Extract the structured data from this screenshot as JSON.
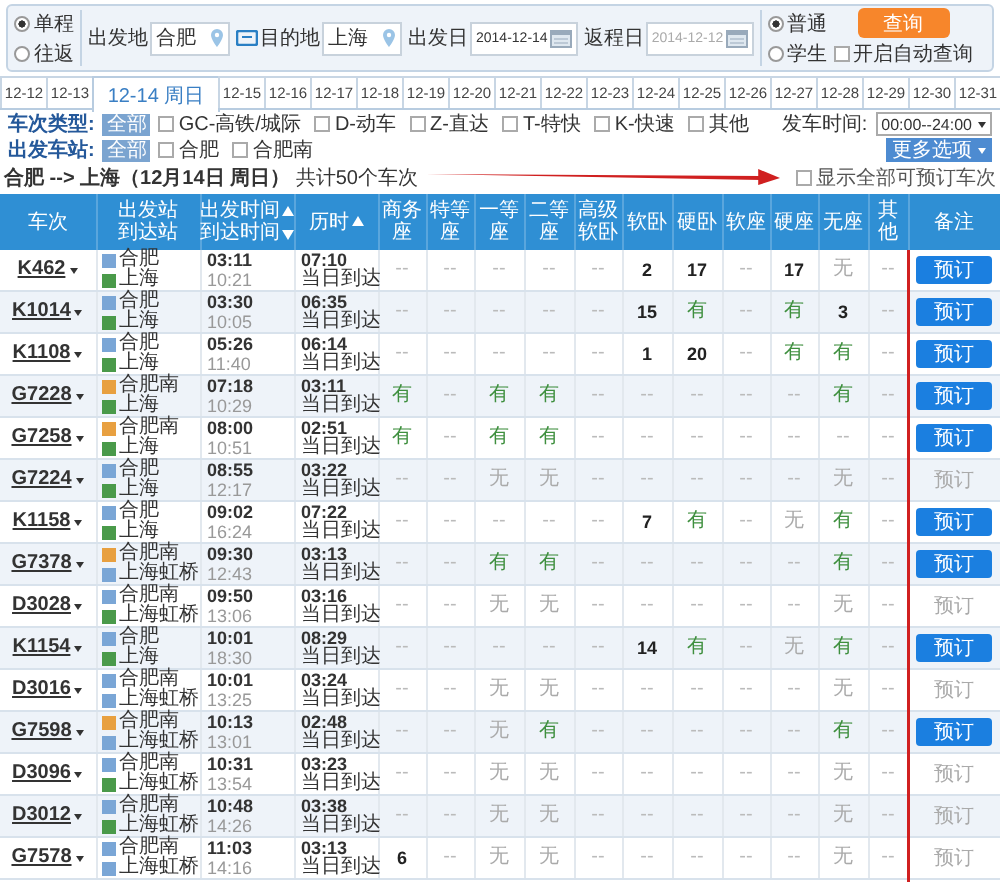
{
  "trip_type": [
    {
      "label": "单程",
      "selected": true
    },
    {
      "label": "往返",
      "selected": false
    }
  ],
  "from": {
    "label": "出发地",
    "value": "合肥"
  },
  "to": {
    "label": "目的地",
    "value": "上海"
  },
  "depart_date": {
    "label": "出发日",
    "value": "2014-12-14"
  },
  "return_date": {
    "label": "返程日",
    "value": "2014-12-12",
    "disabled": true
  },
  "passenger_type": [
    {
      "label": "普通",
      "selected": true
    },
    {
      "label": "学生",
      "selected": false
    }
  ],
  "search_button": "查询",
  "auto_query": {
    "label": "开启自动查询",
    "checked": false
  },
  "date_tabs": [
    {
      "label": "12-12",
      "selected": false
    },
    {
      "label": "12-13",
      "selected": false
    },
    {
      "label": "12-14 周日",
      "selected": true
    },
    {
      "label": "12-15",
      "selected": false
    },
    {
      "label": "12-16",
      "selected": false
    },
    {
      "label": "12-17",
      "selected": false
    },
    {
      "label": "12-18",
      "selected": false
    },
    {
      "label": "12-19",
      "selected": false
    },
    {
      "label": "12-20",
      "selected": false
    },
    {
      "label": "12-21",
      "selected": false
    },
    {
      "label": "12-22",
      "selected": false
    },
    {
      "label": "12-23",
      "selected": false
    },
    {
      "label": "12-24",
      "selected": false
    },
    {
      "label": "12-25",
      "selected": false
    },
    {
      "label": "12-26",
      "selected": false
    },
    {
      "label": "12-27",
      "selected": false
    },
    {
      "label": "12-28",
      "selected": false
    },
    {
      "label": "12-29",
      "selected": false
    },
    {
      "label": "12-30",
      "selected": false
    },
    {
      "label": "12-31",
      "selected": false
    }
  ],
  "train_type_filter": {
    "label": "车次类型:",
    "options": [
      {
        "label": "全部",
        "selected": true
      },
      {
        "label": "GC-高铁/城际",
        "selected": false
      },
      {
        "label": "D-动车",
        "selected": false
      },
      {
        "label": "Z-直达",
        "selected": false
      },
      {
        "label": "T-特快",
        "selected": false
      },
      {
        "label": "K-快速",
        "selected": false
      },
      {
        "label": "其他",
        "selected": false
      }
    ]
  },
  "departure_time": {
    "label": "发车时间:",
    "value": "00:00--24:00"
  },
  "station_filter": {
    "label": "出发车站:",
    "options": [
      {
        "label": "全部",
        "selected": true
      },
      {
        "label": "合肥",
        "selected": false
      },
      {
        "label": "合肥南",
        "selected": false
      }
    ]
  },
  "more_options": "更多选项",
  "summary": "**合肥 --> 上海（12月14日 周日）** 共计50个车次",
  "show_all": {
    "label": "显示全部可预订车次",
    "checked": false
  },
  "table": {
    "columns": [
      {
        "lines": [
          {
            "text": "车次"
          }
        ]
      },
      {
        "lines": [
          {
            "text": "出发站"
          },
          {
            "text": "到达站"
          }
        ]
      },
      {
        "lines": [
          {
            "text": "出发时间",
            "sort_ascending": true
          },
          {
            "text": "到达时间",
            "sort_ascending": false
          }
        ]
      },
      {
        "lines": [
          {
            "text": "历时",
            "sort_ascending": true
          }
        ]
      },
      {
        "lines": [
          {
            "text": "商务座"
          }
        ]
      },
      {
        "lines": [
          {
            "text": "特等座"
          }
        ]
      },
      {
        "lines": [
          {
            "text": "一等座"
          }
        ]
      },
      {
        "lines": [
          {
            "text": "二等座"
          }
        ]
      },
      {
        "lines": [
          {
            "text": "高级软卧"
          }
        ]
      },
      {
        "lines": [
          {
            "text": "软卧"
          }
        ]
      },
      {
        "lines": [
          {
            "text": "硬卧"
          }
        ]
      },
      {
        "lines": [
          {
            "text": "软座"
          }
        ]
      },
      {
        "lines": [
          {
            "text": "硬座"
          }
        ]
      },
      {
        "lines": [
          {
            "text": "无座"
          }
        ]
      },
      {
        "lines": [
          {
            "text": "其他"
          }
        ]
      },
      {
        "lines": [
          {
            "text": "备注"
          }
        ]
      }
    ],
    "rows": [
      {
        "train": "K462",
        "stations": [
          {
            "name": "合肥",
            "color": "#7aa6d6"
          },
          {
            "name": "上海",
            "color": "#4a9a4a"
          }
        ],
        "depart": "03:11",
        "arrive": "10:21",
        "duration": "07:10",
        "arrival_day": "当日到达",
        "seats": [
          {
            "text": "--",
            "kind": "na"
          },
          {
            "text": "--",
            "kind": "na"
          },
          {
            "text": "--",
            "kind": "na"
          },
          {
            "text": "--",
            "kind": "na"
          },
          {
            "text": "--",
            "kind": "na"
          },
          {
            "text": "2",
            "kind": "count"
          },
          {
            "text": "17",
            "kind": "count"
          },
          {
            "text": "--",
            "kind": "na"
          },
          {
            "text": "17",
            "kind": "count"
          },
          {
            "text": "无",
            "kind": "none"
          },
          {
            "text": "--",
            "kind": "na"
          }
        ],
        "book": {
          "label": "预订",
          "disabled": false
        }
      },
      {
        "train": "K1014",
        "stations": [
          {
            "name": "合肥",
            "color": "#7aa6d6"
          },
          {
            "name": "上海",
            "color": "#4a9a4a"
          }
        ],
        "depart": "03:30",
        "arrive": "10:05",
        "duration": "06:35",
        "arrival_day": "当日到达",
        "seats": [
          {
            "text": "--",
            "kind": "na"
          },
          {
            "text": "--",
            "kind": "na"
          },
          {
            "text": "--",
            "kind": "na"
          },
          {
            "text": "--",
            "kind": "na"
          },
          {
            "text": "--",
            "kind": "na"
          },
          {
            "text": "15",
            "kind": "count"
          },
          {
            "text": "有",
            "kind": "have"
          },
          {
            "text": "--",
            "kind": "na"
          },
          {
            "text": "有",
            "kind": "have"
          },
          {
            "text": "3",
            "kind": "count"
          },
          {
            "text": "--",
            "kind": "na"
          }
        ],
        "book": {
          "label": "预订",
          "disabled": false
        }
      },
      {
        "train": "K1108",
        "stations": [
          {
            "name": "合肥",
            "color": "#7aa6d6"
          },
          {
            "name": "上海",
            "color": "#4a9a4a"
          }
        ],
        "depart": "05:26",
        "arrive": "11:40",
        "duration": "06:14",
        "arrival_day": "当日到达",
        "seats": [
          {
            "text": "--",
            "kind": "na"
          },
          {
            "text": "--",
            "kind": "na"
          },
          {
            "text": "--",
            "kind": "na"
          },
          {
            "text": "--",
            "kind": "na"
          },
          {
            "text": "--",
            "kind": "na"
          },
          {
            "text": "1",
            "kind": "count"
          },
          {
            "text": "20",
            "kind": "count"
          },
          {
            "text": "--",
            "kind": "na"
          },
          {
            "text": "有",
            "kind": "have"
          },
          {
            "text": "有",
            "kind": "have"
          },
          {
            "text": "--",
            "kind": "na"
          }
        ],
        "book": {
          "label": "预订",
          "disabled": false
        }
      },
      {
        "train": "G7228",
        "stations": [
          {
            "name": "合肥南",
            "color": "#e8a040"
          },
          {
            "name": "上海",
            "color": "#4a9a4a"
          }
        ],
        "depart": "07:18",
        "arrive": "10:29",
        "duration": "03:11",
        "arrival_day": "当日到达",
        "seats": [
          {
            "text": "有",
            "kind": "have"
          },
          {
            "text": "--",
            "kind": "na"
          },
          {
            "text": "有",
            "kind": "have"
          },
          {
            "text": "有",
            "kind": "have"
          },
          {
            "text": "--",
            "kind": "na"
          },
          {
            "text": "--",
            "kind": "na"
          },
          {
            "text": "--",
            "kind": "na"
          },
          {
            "text": "--",
            "kind": "na"
          },
          {
            "text": "--",
            "kind": "na"
          },
          {
            "text": "有",
            "kind": "have"
          },
          {
            "text": "--",
            "kind": "na"
          }
        ],
        "book": {
          "label": "预订",
          "disabled": false
        }
      },
      {
        "train": "G7258",
        "stations": [
          {
            "name": "合肥南",
            "color": "#e8a040"
          },
          {
            "name": "上海",
            "color": "#4a9a4a"
          }
        ],
        "depart": "08:00",
        "arrive": "10:51",
        "duration": "02:51",
        "arrival_day": "当日到达",
        "seats": [
          {
            "text": "有",
            "kind": "have"
          },
          {
            "text": "--",
            "kind": "na"
          },
          {
            "text": "有",
            "kind": "have"
          },
          {
            "text": "有",
            "kind": "have"
          },
          {
            "text": "--",
            "kind": "na"
          },
          {
            "text": "--",
            "kind": "na"
          },
          {
            "text": "--",
            "kind": "na"
          },
          {
            "text": "--",
            "kind": "na"
          },
          {
            "text": "--",
            "kind": "na"
          },
          {
            "text": "--",
            "kind": "na"
          },
          {
            "text": "--",
            "kind": "na"
          }
        ],
        "book": {
          "label": "预订",
          "disabled": false
        }
      },
      {
        "train": "G7224",
        "stations": [
          {
            "name": "合肥",
            "color": "#7aa6d6"
          },
          {
            "name": "上海",
            "color": "#4a9a4a"
          }
        ],
        "depart": "08:55",
        "arrive": "12:17",
        "duration": "03:22",
        "arrival_day": "当日到达",
        "seats": [
          {
            "text": "--",
            "kind": "na"
          },
          {
            "text": "--",
            "kind": "na"
          },
          {
            "text": "无",
            "kind": "none"
          },
          {
            "text": "无",
            "kind": "none"
          },
          {
            "text": "--",
            "kind": "na"
          },
          {
            "text": "--",
            "kind": "na"
          },
          {
            "text": "--",
            "kind": "na"
          },
          {
            "text": "--",
            "kind": "na"
          },
          {
            "text": "--",
            "kind": "na"
          },
          {
            "text": "无",
            "kind": "none"
          },
          {
            "text": "--",
            "kind": "na"
          }
        ],
        "book": {
          "label": "预订",
          "disabled": true
        }
      },
      {
        "train": "K1158",
        "stations": [
          {
            "name": "合肥",
            "color": "#7aa6d6"
          },
          {
            "name": "上海",
            "color": "#4a9a4a"
          }
        ],
        "depart": "09:02",
        "arrive": "16:24",
        "duration": "07:22",
        "arrival_day": "当日到达",
        "seats": [
          {
            "text": "--",
            "kind": "na"
          },
          {
            "text": "--",
            "kind": "na"
          },
          {
            "text": "--",
            "kind": "na"
          },
          {
            "text": "--",
            "kind": "na"
          },
          {
            "text": "--",
            "kind": "na"
          },
          {
            "text": "7",
            "kind": "count"
          },
          {
            "text": "有",
            "kind": "have"
          },
          {
            "text": "--",
            "kind": "na"
          },
          {
            "text": "无",
            "kind": "none"
          },
          {
            "text": "有",
            "kind": "have"
          },
          {
            "text": "--",
            "kind": "na"
          }
        ],
        "book": {
          "label": "预订",
          "disabled": false
        }
      },
      {
        "train": "G7378",
        "stations": [
          {
            "name": "合肥南",
            "color": "#e8a040"
          },
          {
            "name": "上海虹桥",
            "color": "#7aa6d6"
          }
        ],
        "depart": "09:30",
        "arrive": "12:43",
        "duration": "03:13",
        "arrival_day": "当日到达",
        "seats": [
          {
            "text": "--",
            "kind": "na"
          },
          {
            "text": "--",
            "kind": "na"
          },
          {
            "text": "有",
            "kind": "have"
          },
          {
            "text": "有",
            "kind": "have"
          },
          {
            "text": "--",
            "kind": "na"
          },
          {
            "text": "--",
            "kind": "na"
          },
          {
            "text": "--",
            "kind": "na"
          },
          {
            "text": "--",
            "kind": "na"
          },
          {
            "text": "--",
            "kind": "na"
          },
          {
            "text": "有",
            "kind": "have"
          },
          {
            "text": "--",
            "kind": "na"
          }
        ],
        "book": {
          "label": "预订",
          "disabled": false
        }
      },
      {
        "train": "D3028",
        "stations": [
          {
            "name": "合肥南",
            "color": "#7aa6d6"
          },
          {
            "name": "上海虹桥",
            "color": "#4a9a4a"
          }
        ],
        "depart": "09:50",
        "arrive": "13:06",
        "duration": "03:16",
        "arrival_day": "当日到达",
        "seats": [
          {
            "text": "--",
            "kind": "na"
          },
          {
            "text": "--",
            "kind": "na"
          },
          {
            "text": "无",
            "kind": "none"
          },
          {
            "text": "无",
            "kind": "none"
          },
          {
            "text": "--",
            "kind": "na"
          },
          {
            "text": "--",
            "kind": "na"
          },
          {
            "text": "--",
            "kind": "na"
          },
          {
            "text": "--",
            "kind": "na"
          },
          {
            "text": "--",
            "kind": "na"
          },
          {
            "text": "无",
            "kind": "none"
          },
          {
            "text": "--",
            "kind": "na"
          }
        ],
        "book": {
          "label": "预订",
          "disabled": true
        }
      },
      {
        "train": "K1154",
        "stations": [
          {
            "name": "合肥",
            "color": "#7aa6d6"
          },
          {
            "name": "上海",
            "color": "#4a9a4a"
          }
        ],
        "depart": "10:01",
        "arrive": "18:30",
        "duration": "08:29",
        "arrival_day": "当日到达",
        "seats": [
          {
            "text": "--",
            "kind": "na"
          },
          {
            "text": "--",
            "kind": "na"
          },
          {
            "text": "--",
            "kind": "na"
          },
          {
            "text": "--",
            "kind": "na"
          },
          {
            "text": "--",
            "kind": "na"
          },
          {
            "text": "14",
            "kind": "count"
          },
          {
            "text": "有",
            "kind": "have"
          },
          {
            "text": "--",
            "kind": "na"
          },
          {
            "text": "无",
            "kind": "none"
          },
          {
            "text": "有",
            "kind": "have"
          },
          {
            "text": "--",
            "kind": "na"
          }
        ],
        "book": {
          "label": "预订",
          "disabled": false
        }
      },
      {
        "train": "D3016",
        "stations": [
          {
            "name": "合肥南",
            "color": "#7aa6d6"
          },
          {
            "name": "上海虹桥",
            "color": "#7aa6d6"
          }
        ],
        "depart": "10:01",
        "arrive": "13:25",
        "duration": "03:24",
        "arrival_day": "当日到达",
        "seats": [
          {
            "text": "--",
            "kind": "na"
          },
          {
            "text": "--",
            "kind": "na"
          },
          {
            "text": "无",
            "kind": "none"
          },
          {
            "text": "无",
            "kind": "none"
          },
          {
            "text": "--",
            "kind": "na"
          },
          {
            "text": "--",
            "kind": "na"
          },
          {
            "text": "--",
            "kind": "na"
          },
          {
            "text": "--",
            "kind": "na"
          },
          {
            "text": "--",
            "kind": "na"
          },
          {
            "text": "无",
            "kind": "none"
          },
          {
            "text": "--",
            "kind": "na"
          }
        ],
        "book": {
          "label": "预订",
          "disabled": true
        }
      },
      {
        "train": "G7598",
        "stations": [
          {
            "name": "合肥南",
            "color": "#e8a040"
          },
          {
            "name": "上海虹桥",
            "color": "#7aa6d6"
          }
        ],
        "depart": "10:13",
        "arrive": "13:01",
        "duration": "02:48",
        "arrival_day": "当日到达",
        "seats": [
          {
            "text": "--",
            "kind": "na"
          },
          {
            "text": "--",
            "kind": "na"
          },
          {
            "text": "无",
            "kind": "none"
          },
          {
            "text": "有",
            "kind": "have"
          },
          {
            "text": "--",
            "kind": "na"
          },
          {
            "text": "--",
            "kind": "na"
          },
          {
            "text": "--",
            "kind": "na"
          },
          {
            "text": "--",
            "kind": "na"
          },
          {
            "text": "--",
            "kind": "na"
          },
          {
            "text": "有",
            "kind": "have"
          },
          {
            "text": "--",
            "kind": "na"
          }
        ],
        "book": {
          "label": "预订",
          "disabled": false
        }
      },
      {
        "train": "D3096",
        "stations": [
          {
            "name": "合肥南",
            "color": "#7aa6d6"
          },
          {
            "name": "上海虹桥",
            "color": "#4a9a4a"
          }
        ],
        "depart": "10:31",
        "arrive": "13:54",
        "duration": "03:23",
        "arrival_day": "当日到达",
        "seats": [
          {
            "text": "--",
            "kind": "na"
          },
          {
            "text": "--",
            "kind": "na"
          },
          {
            "text": "无",
            "kind": "none"
          },
          {
            "text": "无",
            "kind": "none"
          },
          {
            "text": "--",
            "kind": "na"
          },
          {
            "text": "--",
            "kind": "na"
          },
          {
            "text": "--",
            "kind": "na"
          },
          {
            "text": "--",
            "kind": "na"
          },
          {
            "text": "--",
            "kind": "na"
          },
          {
            "text": "无",
            "kind": "none"
          },
          {
            "text": "--",
            "kind": "na"
          }
        ],
        "book": {
          "label": "预订",
          "disabled": true
        }
      },
      {
        "train": "D3012",
        "stations": [
          {
            "name": "合肥南",
            "color": "#7aa6d6"
          },
          {
            "name": "上海虹桥",
            "color": "#4a9a4a"
          }
        ],
        "depart": "10:48",
        "arrive": "14:26",
        "duration": "03:38",
        "arrival_day": "当日到达",
        "seats": [
          {
            "text": "--",
            "kind": "na"
          },
          {
            "text": "--",
            "kind": "na"
          },
          {
            "text": "无",
            "kind": "none"
          },
          {
            "text": "无",
            "kind": "none"
          },
          {
            "text": "--",
            "kind": "na"
          },
          {
            "text": "--",
            "kind": "na"
          },
          {
            "text": "--",
            "kind": "na"
          },
          {
            "text": "--",
            "kind": "na"
          },
          {
            "text": "--",
            "kind": "na"
          },
          {
            "text": "无",
            "kind": "none"
          },
          {
            "text": "--",
            "kind": "na"
          }
        ],
        "book": {
          "label": "预订",
          "disabled": true
        }
      },
      {
        "train": "G7578",
        "stations": [
          {
            "name": "合肥南",
            "color": "#7aa6d6"
          },
          {
            "name": "上海虹桥",
            "color": "#7aa6d6"
          }
        ],
        "depart": "11:03",
        "arrive": "14:16",
        "duration": "03:13",
        "arrival_day": "当日到达",
        "seats": [
          {
            "text": "6",
            "kind": "count"
          },
          {
            "text": "--",
            "kind": "na"
          },
          {
            "text": "无",
            "kind": "none"
          },
          {
            "text": "无",
            "kind": "none"
          },
          {
            "text": "--",
            "kind": "na"
          },
          {
            "text": "--",
            "kind": "na"
          },
          {
            "text": "--",
            "kind": "na"
          },
          {
            "text": "--",
            "kind": "na"
          },
          {
            "text": "--",
            "kind": "na"
          },
          {
            "text": "无",
            "kind": "none"
          },
          {
            "text": "--",
            "kind": "na"
          }
        ],
        "book": {
          "label": "预订",
          "disabled": true
        }
      }
    ]
  }
}
